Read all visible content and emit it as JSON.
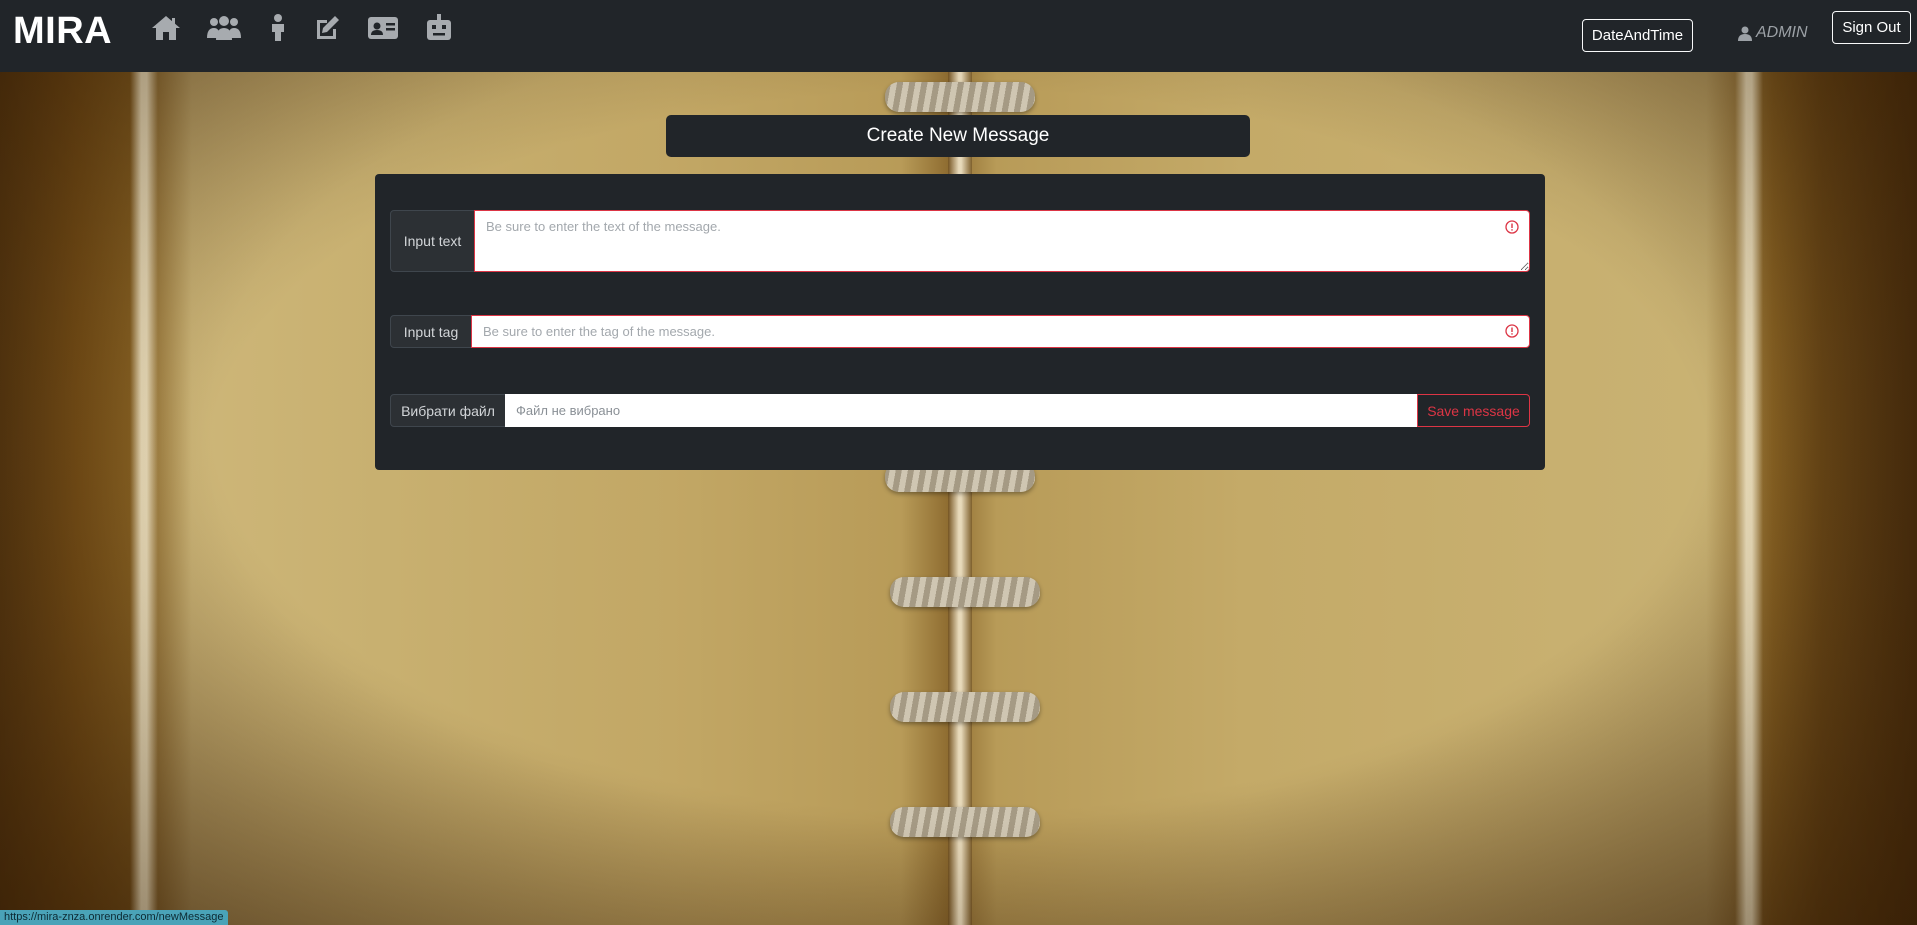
{
  "navbar": {
    "brand": "MIRA",
    "icons": [
      "home-icon",
      "users-icon",
      "person-icon",
      "edit-icon",
      "id-card-icon",
      "robot-icon"
    ],
    "date_button": "DateAndTime",
    "user_label": "ADMIN",
    "signout_button": "Sign Out"
  },
  "page": {
    "title": "Create New Message"
  },
  "form": {
    "text_label": "Input text",
    "text_placeholder": "Be sure to enter the text of the message.",
    "tag_label": "Input tag",
    "tag_placeholder": "Be sure to enter the tag of the message.",
    "file_button": "Вибрати файл",
    "file_name": "Файл не вибрано",
    "save_button": "Save message"
  },
  "status_bar": {
    "url": "https://mira-znza.onrender.com/newMessage"
  },
  "colors": {
    "navbar": "#212529",
    "danger": "#dc3545",
    "status_bar": "#4aa3b8"
  }
}
